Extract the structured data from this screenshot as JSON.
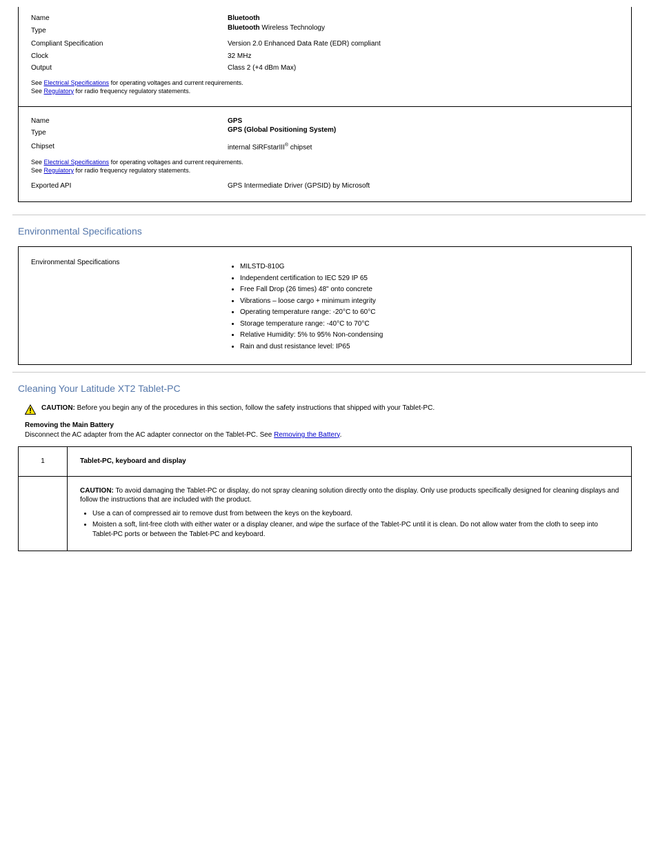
{
  "rf": {
    "bt": {
      "name_label": "Name",
      "name_value": "Bluetooth",
      "type_label": "Type",
      "type_bold": "Bluetooth",
      "type_rest": " Wireless Technology",
      "spec_label": "Compliant Specification",
      "spec_value": "Version 2.0 Enhanced Data Rate (EDR) compliant",
      "clock_label": "Clock",
      "clock_value": "32 MHz",
      "output_label": "Output",
      "output_value": "Class 2 (+4 dBm Max)",
      "note_prefix": "See ",
      "note_link": "Electrical Specifications",
      "note_mid": " for operating voltages and current requirements.\nSee ",
      "note_link2": "Regulatory",
      "note_end": " for radio frequency regulatory statements."
    },
    "gps": {
      "name_label": "Name",
      "name_value": "GPS",
      "type_label": "Type",
      "type_value": "GPS (Global Positioning System)",
      "chipset_label": "Chipset",
      "chipset_span": "internal SiRFstarIII",
      "chipset_sup": "®",
      "chipset_rest": " chipset",
      "note_prefix": "See ",
      "note_link": "Electrical Specifications",
      "note_mid": " for operating voltages and current requirements.\nSee ",
      "note_link2": "Regulatory",
      "note_end": " for radio frequency regulatory statements.",
      "exported_label": "Exported API",
      "exported_value": "GPS Intermediate Driver (GPSID) by Microsoft"
    }
  },
  "env": {
    "heading": "Environmental Specifications",
    "label": "Environmental Specifications",
    "bullets": [
      "MILSTD-810G",
      "Independent certification to IEC 529 IP 65",
      "Free Fall Drop (26 times) 48\" onto concrete",
      "Vibrations – loose cargo + minimum integrity",
      "Operating temperature range: -20°C to 60°C",
      "Storage temperature range: -40°C to 70°C",
      "Relative Humidity: 5% to 95% Non-condensing",
      "Rain and dust resistance level: IP65"
    ]
  },
  "clean": {
    "heading": "Cleaning Your Latitude XT2 Tablet-PC",
    "caution_bold": "CAUTION:",
    "caution_rest": " Before you begin any of the procedures in this section, follow the safety instructions that shipped with your Tablet-PC.",
    "block_bold": "Removing the Main Battery",
    "block_rest": "\nDisconnect the AC adapter from the AC adapter connector on the Tablet-PC. See ",
    "block_link": "Removing the Battery",
    "block_end": ".",
    "r1_step": "1",
    "r1_title": "Tablet-PC, keyboard and display",
    "r2_step": "",
    "r2_caution_bold": "CAUTION:",
    "r2_caution_rest": " To avoid damaging the Tablet-PC or display, do not spray cleaning solution directly onto the display. Only use products specifically designed for cleaning displays and follow the instructions that are included with the product.",
    "r2_b1": "Use a can of compressed air to remove dust from between the keys on the keyboard.",
    "r2_b2": "Moisten a soft, lint-free cloth with either water or a display cleaner, and wipe the surface of the Tablet-PC until it is clean. Do not allow water from the cloth to seep into Tablet-PC ports or between the Tablet-PC and keyboard."
  }
}
